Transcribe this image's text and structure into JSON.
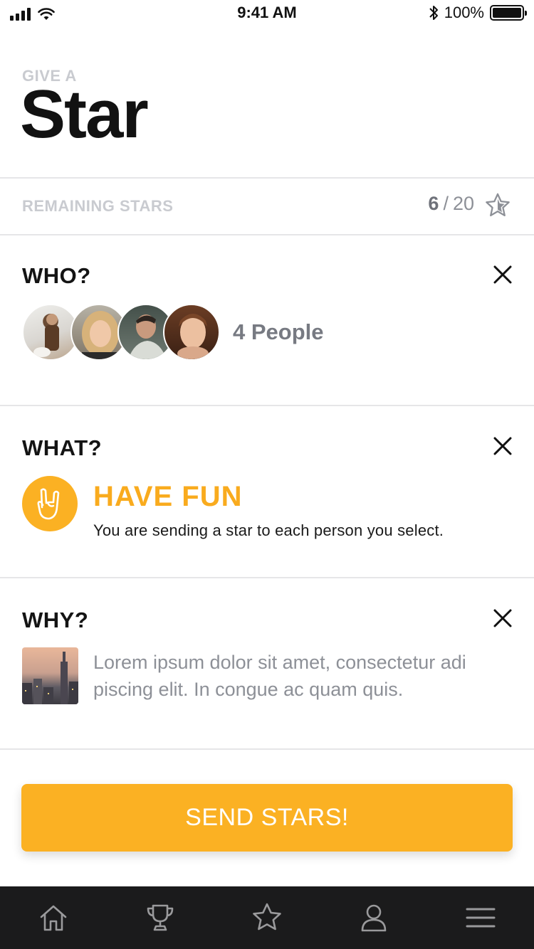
{
  "status_bar": {
    "time": "9:41 AM",
    "battery": "100%"
  },
  "header": {
    "kicker": "GIVE A",
    "title": "Star"
  },
  "remaining": {
    "label": "REMAINING STARS",
    "current": "6",
    "separator": "/",
    "total": "20"
  },
  "who": {
    "title": "WHO?",
    "people_count": "4 People",
    "avatar_count": 4
  },
  "what": {
    "title": "WHAT?",
    "option": "HAVE FUN",
    "description": "You are sending a star to each person you select."
  },
  "why": {
    "title": "WHY?",
    "message": "Lorem ipsum dolor sit amet, consectetur adi piscing elit. In congue ac quam quis."
  },
  "action": {
    "send_label": "SEND STARS!"
  },
  "tabbar": {
    "items": [
      "home-icon",
      "trophy-icon",
      "star-icon",
      "profile-icon",
      "menu-icon"
    ]
  },
  "colors": {
    "accent": "#fbb123",
    "accent_text": "#f9ab1e",
    "tabbar_bg": "#1b1b1c",
    "muted": "#c9cbd0"
  }
}
